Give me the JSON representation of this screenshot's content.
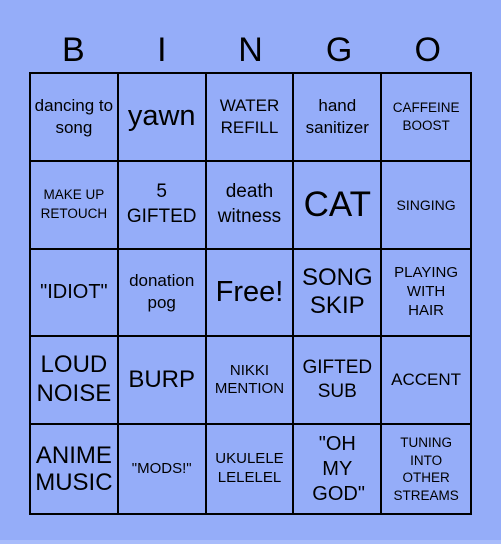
{
  "header": {
    "letters": [
      "B",
      "I",
      "N",
      "G",
      "O"
    ]
  },
  "board": {
    "cells": [
      {
        "text": "dancing to song",
        "free": false
      },
      {
        "text": "yawn",
        "free": false
      },
      {
        "text": "WATER REFILL",
        "free": false
      },
      {
        "text": "hand sanitizer",
        "free": false
      },
      {
        "text": "CAFFEINE BOOST",
        "free": false
      },
      {
        "text": "MAKE UP RETOUCH",
        "free": false
      },
      {
        "text": "5 GIFTED",
        "free": false
      },
      {
        "text": "death witness",
        "free": false
      },
      {
        "text": "CAT",
        "free": false
      },
      {
        "text": "SINGING",
        "free": false
      },
      {
        "text": "\"IDIOT\"",
        "free": false
      },
      {
        "text": "donation pog",
        "free": false
      },
      {
        "text": "Free!",
        "free": true
      },
      {
        "text": "SONG SKIP",
        "free": false
      },
      {
        "text": "PLAYING WITH HAIR",
        "free": false
      },
      {
        "text": "LOUD NOISE",
        "free": false
      },
      {
        "text": "BURP",
        "free": false
      },
      {
        "text": "NIKKI MENTION",
        "free": false
      },
      {
        "text": "GIFTED SUB",
        "free": false
      },
      {
        "text": "ACCENT",
        "free": false
      },
      {
        "text": "ANIME MUSIC",
        "free": false
      },
      {
        "text": "\"MODS!\"",
        "free": false
      },
      {
        "text": "UKULELE LELELEL",
        "free": false
      },
      {
        "text": "\"OH MY GOD\"",
        "free": false
      },
      {
        "text": "TUNING INTO OTHER STREAMS",
        "free": false
      }
    ]
  },
  "colors": {
    "background": "#95adf9",
    "grid_line": "#000000",
    "text": "#000000"
  }
}
